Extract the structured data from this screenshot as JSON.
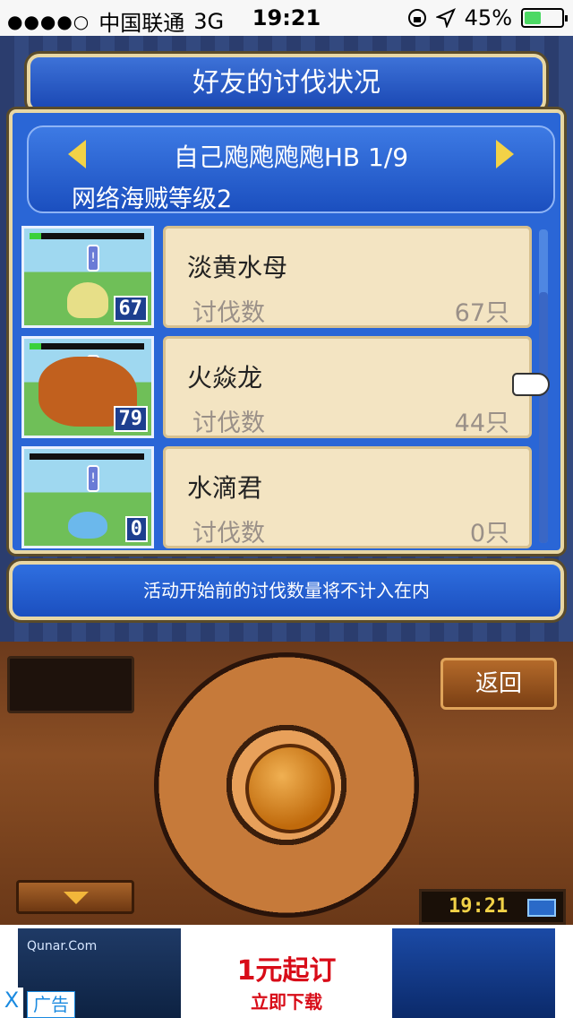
{
  "status_bar": {
    "signal": "●●●●○",
    "carrier": "中国联通",
    "network": "3G",
    "time": "19:21",
    "battery_percent": "45%",
    "battery_level": 0.45
  },
  "dialog": {
    "title": "好友的讨伐状况",
    "friend_line": "自己飑飑飑飑HB 1/9",
    "pirate_level": "网络海贼等级2",
    "notice": "活动开始前的讨伐数量将不计入在内"
  },
  "monsters": [
    {
      "name": "淡黄水母",
      "label": "讨伐数",
      "value": "67只",
      "badge": "67",
      "hp": 0.1
    },
    {
      "name": "火焱龙",
      "label": "讨伐数",
      "value": "44只",
      "badge": "79",
      "hp": 0.1
    },
    {
      "name": "水滴君",
      "label": "讨伐数",
      "value": "0只",
      "badge": "0",
      "hp": 0.0
    }
  ],
  "console": {
    "back_label": "返回",
    "clock": "19:21"
  },
  "ad": {
    "left_brand": "Qunar.Com",
    "main_line": "1元起订",
    "sub_line": "立即下载",
    "close": "X",
    "tag": "广告"
  },
  "colors": {
    "panel_blue": "#2a66d6",
    "card_bg": "#f3e4c2",
    "gold_arrow": "#f2d247",
    "ad_red": "#d80c18"
  },
  "icons": [
    "lock-rotation-icon",
    "location-arrow-icon",
    "battery-icon",
    "arrow-left-icon",
    "arrow-right-icon",
    "pointing-hand-icon",
    "down-arrow-icon"
  ]
}
